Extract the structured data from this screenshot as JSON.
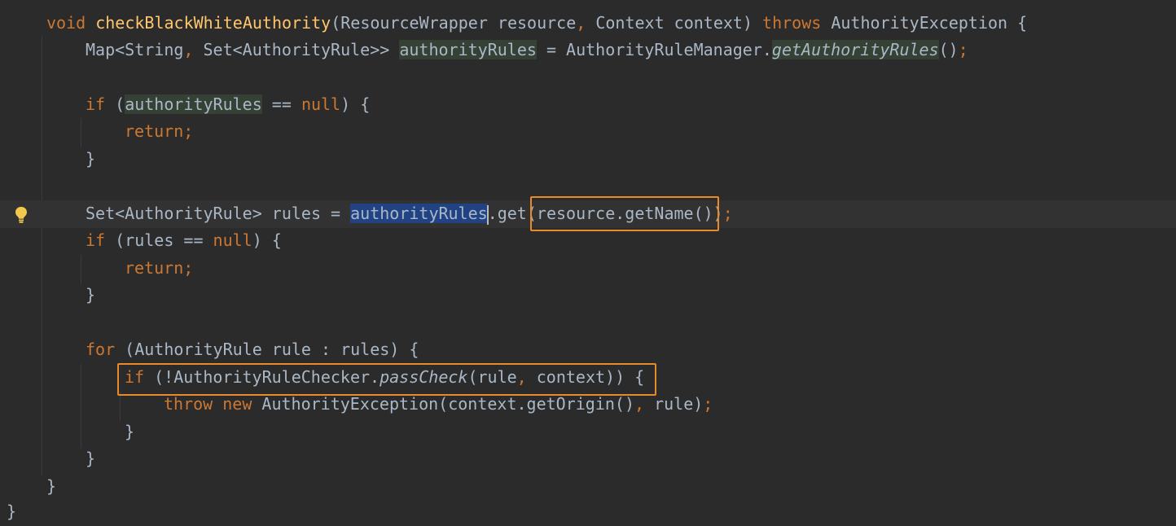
{
  "code": {
    "l1": {
      "kw_void": "void ",
      "method_name": "checkBlackWhiteAuthority",
      "params": "(ResourceWrapper resource",
      "comma": ",",
      "params2": " Context context) ",
      "kw_throws": "throws",
      "rest": " AuthorityException {"
    },
    "l2": {
      "t1": "Map<String",
      "comma": ",",
      "t2": " Set<AuthorityRule>> ",
      "var": "authorityRules",
      "t3": " = AuthorityRuleManager.",
      "method": "getAuthorityRules",
      "t4": "()",
      "semi": ";"
    },
    "l4": {
      "kw_if": "if",
      "t1": " (",
      "var": "authorityRules",
      "t2": " == ",
      "kw_null": "null",
      "t3": ") {"
    },
    "l5": {
      "kw_return": "return;"
    },
    "l6": {
      "brace": "}"
    },
    "l8": {
      "t1": "Set<AuthorityRule> rules = ",
      "var": "authorityRules",
      "t2": ".get(",
      "t3": "resource.getName())",
      "semi": ";"
    },
    "l9": {
      "kw_if": "if",
      "t1": " (rules == ",
      "kw_null": "null",
      "t2": ") {"
    },
    "l10": {
      "kw_return": "return;"
    },
    "l11": {
      "brace": "}"
    },
    "l13": {
      "kw_for": "for",
      "t1": " (AuthorityRule rule : rules) {"
    },
    "l14": {
      "kw_if": "if",
      "t1": " (!AuthorityRuleChecker.",
      "method": "passCheck",
      "t2": "(rule",
      "comma": ",",
      "t3": " context)) {"
    },
    "l15": {
      "kw_throw": "throw",
      "kw_new": " new",
      "t1": " AuthorityException(context.getOrigin()",
      "comma": ",",
      "t2": " rule)",
      "semi": ";"
    },
    "l16": {
      "brace": "}"
    },
    "l17": {
      "brace": "}"
    },
    "l18": {
      "brace": "}"
    },
    "l19": {
      "brace": "}"
    }
  },
  "colors": {
    "background": "#2b2b2b",
    "keyword": "#cc7832",
    "method_declaration": "#ffc66d",
    "plain_text": "#a9b7c6",
    "highlight_box": "#e8892b",
    "selection": "#214283",
    "read_usage": "#344134"
  },
  "icons": {
    "gutter": "lightbulb-icon"
  }
}
